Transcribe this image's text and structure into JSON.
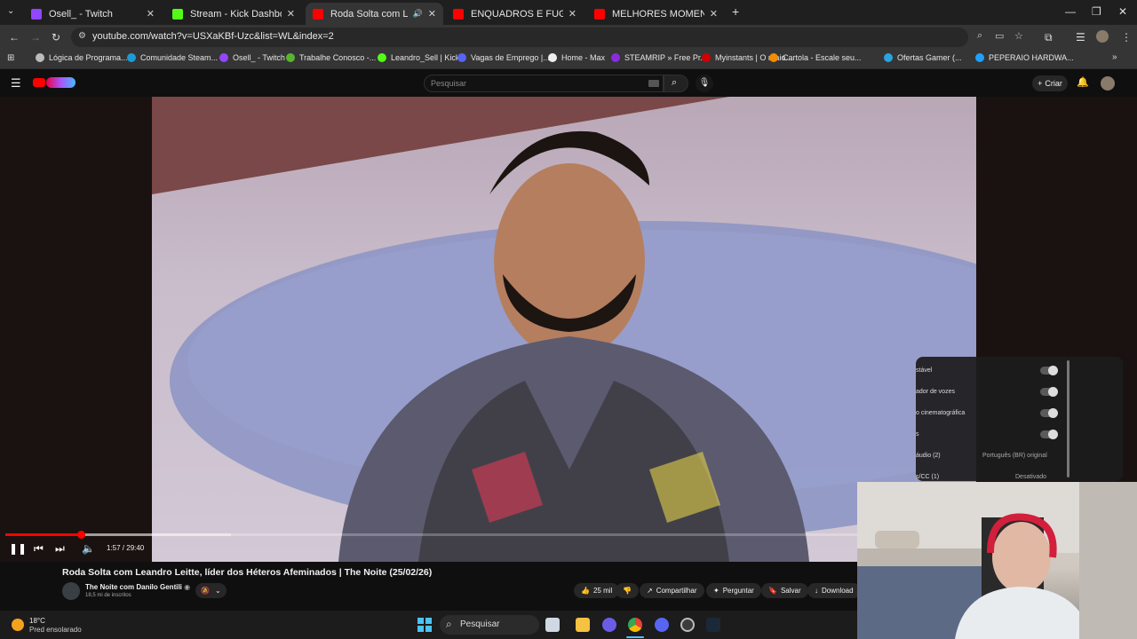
{
  "tabs": [
    {
      "title": "Osell_ - Twitch",
      "color": "#9146ff",
      "active": false
    },
    {
      "title": "Stream - Kick Dashboard",
      "color": "#53fc18",
      "active": false
    },
    {
      "title": "Roda Solta com Leandro Le",
      "color": "#ff0000",
      "active": true
    },
    {
      "title": "ENQUADROS E FUGAS DE MOT",
      "color": "#ff0000",
      "active": false
    },
    {
      "title": "MELHORES MOMENTOS: FLAM",
      "color": "#ff0000",
      "active": false
    }
  ],
  "address": {
    "url": "youtube.com/watch?v=USXaKBf-Uzc&list=WL&index=2"
  },
  "bookmarks": [
    {
      "label": "Lógica de Programa...",
      "color": "#bbbbbb"
    },
    {
      "label": "Comunidade Steam...",
      "color": "#1b9cd8"
    },
    {
      "label": "Osell_ - Twitch",
      "color": "#9146ff"
    },
    {
      "label": "Trabalhe Conosco -...",
      "color": "#58b530"
    },
    {
      "label": "Leandro_Sell | Kick",
      "color": "#53fc18"
    },
    {
      "label": "Vagas de Emprego |...",
      "color": "#5865f2"
    },
    {
      "label": "Home - Max",
      "color": "#eeeeee"
    },
    {
      "label": "STEAMRIP » Free Pr...",
      "color": "#8a2be2"
    },
    {
      "label": "Myinstants | O maio...",
      "color": "#d00000"
    },
    {
      "label": "Cartola - Escale seu...",
      "color": "#f28c00"
    },
    {
      "label": "Ofertas Gamer (...",
      "color": "#2aa3e0"
    },
    {
      "label": "PEPERAIO HARDWA...",
      "color": "#1fa0ff"
    }
  ],
  "yt": {
    "search_placeholder": "Pesquisar",
    "create_label": "Criar"
  },
  "player": {
    "progress_fraction": 0.067,
    "buffer_fraction": 0.2,
    "time_text": "1:57 / 29:40",
    "settings": {
      "rows": [
        {
          "label": "stável",
          "value": "",
          "toggle": true
        },
        {
          "label": "ador de vozes",
          "value": "",
          "toggle": true
        },
        {
          "label": "o cinematográfica",
          "value": "",
          "toggle": true
        },
        {
          "label": "s",
          "value": "",
          "toggle": true
        },
        {
          "label": "áudio (2)",
          "value": "Português (BR) original",
          "toggle": false
        },
        {
          "label": "s/CC (1)",
          "value": "Desativado",
          "toggle": false
        }
      ]
    }
  },
  "video": {
    "title": "Roda Solta com Leandro Leitte, líder dos Héteros Afeminados | The Noite (25/02/26)",
    "channel": "The Noite com Danilo Gentili",
    "subscribers": "18,5 mi de inscritos",
    "likes": "25 mil",
    "share_label": "Compartilhar",
    "ask_label": "Perguntar",
    "save_label": "Salvar",
    "download_label": "Download"
  },
  "taskbar": {
    "temperature": "18°C",
    "weather": "Pred ensolarado",
    "search_label": "Pesquisar"
  }
}
